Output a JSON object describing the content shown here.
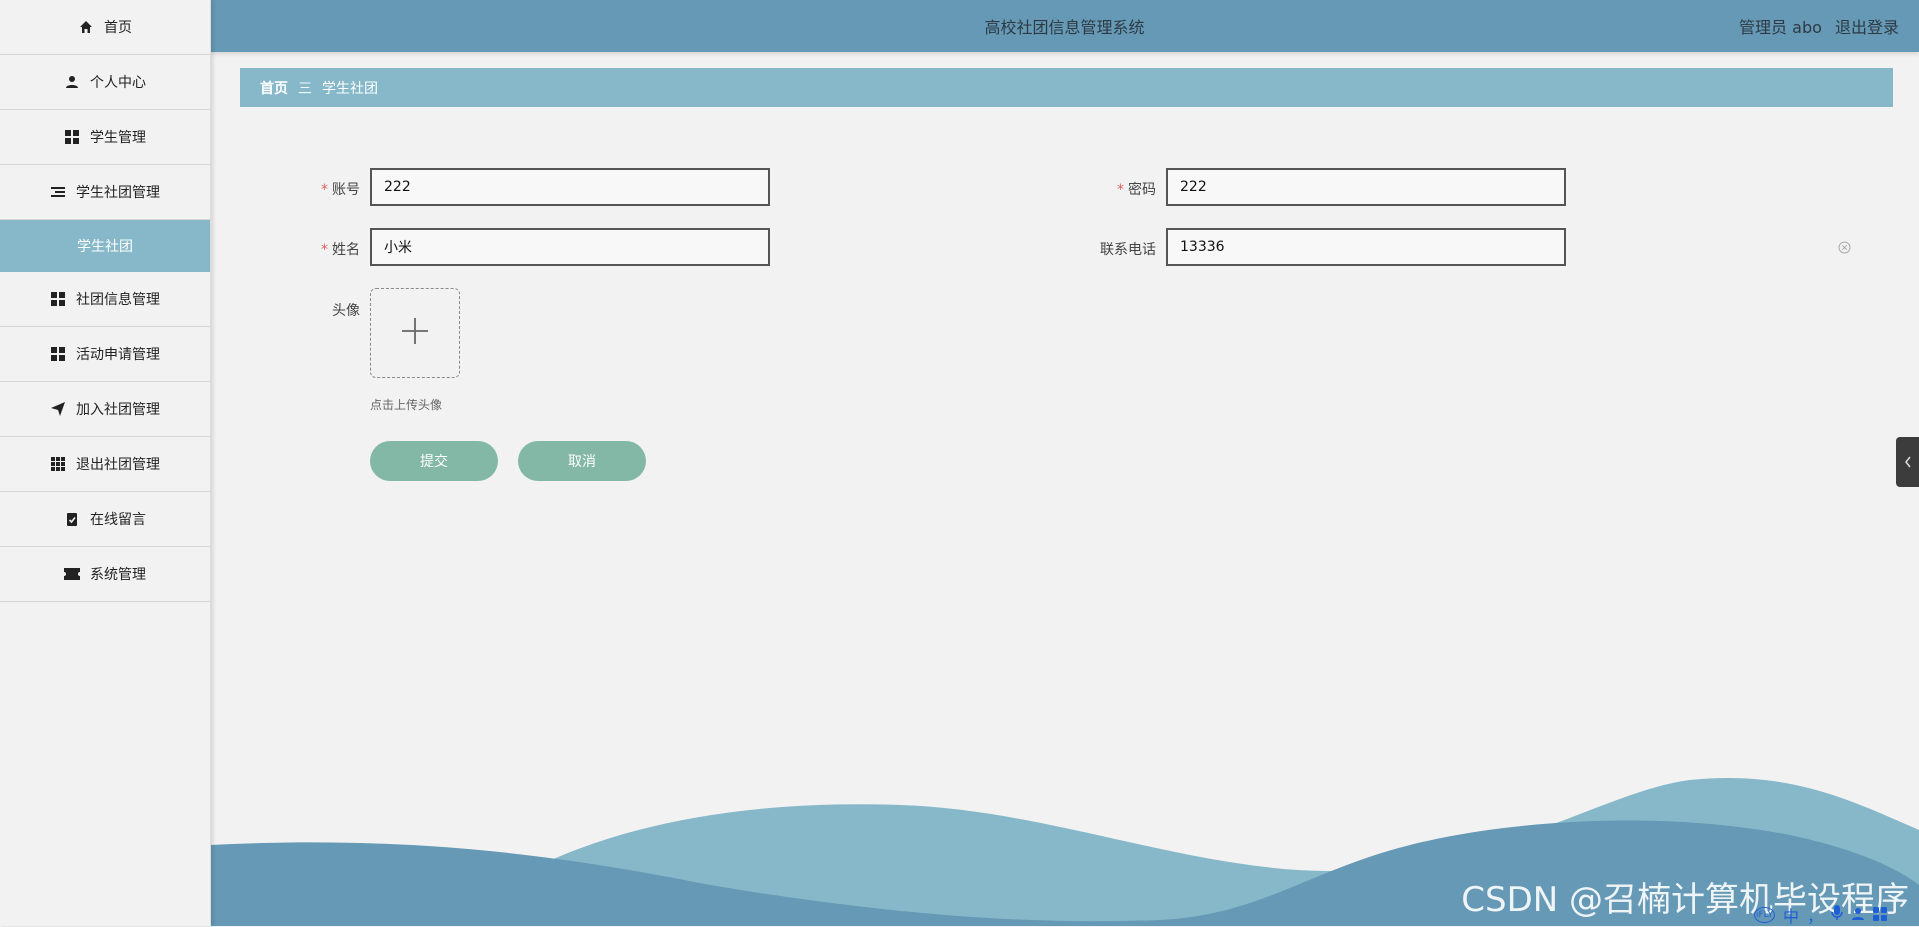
{
  "header": {
    "title": "高校社团信息管理系统",
    "user_label": "管理员 abo",
    "logout_label": "退出登录"
  },
  "sidebar": {
    "items": [
      {
        "label": "首页",
        "icon": "home-icon"
      },
      {
        "label": "个人中心",
        "icon": "user-icon"
      },
      {
        "label": "学生管理",
        "icon": "grid-icon"
      },
      {
        "label": "学生社团管理",
        "icon": "list-icon"
      },
      {
        "label": "学生社团",
        "icon": "",
        "active": true
      },
      {
        "label": "社团信息管理",
        "icon": "grid-icon"
      },
      {
        "label": "活动申请管理",
        "icon": "grid-icon"
      },
      {
        "label": "加入社团管理",
        "icon": "paper-plane-icon"
      },
      {
        "label": "退出社团管理",
        "icon": "apps-icon"
      },
      {
        "label": "在线留言",
        "icon": "clipboard-check-icon"
      },
      {
        "label": "系统管理",
        "icon": "ticket-icon"
      }
    ]
  },
  "breadcrumb": {
    "home": "首页",
    "separator": "三",
    "current": "学生社团"
  },
  "form": {
    "account": {
      "label": "账号",
      "value": "222",
      "required": true
    },
    "password": {
      "label": "密码",
      "value": "222",
      "required": true
    },
    "name": {
      "label": "姓名",
      "value": "小米",
      "required": true
    },
    "phone": {
      "label": "联系电话",
      "value": "13336",
      "required": false
    },
    "avatar": {
      "label": "头像",
      "tip": "点击上传头像"
    },
    "submit_label": "提交",
    "cancel_label": "取消"
  },
  "watermark": "CSDN @召楠计算机毕设程序",
  "ime": {
    "logo": "iFLY",
    "lang": "中",
    "punct": "，"
  },
  "colors": {
    "header": "#6599b5",
    "accent": "#86b8c9",
    "button": "#82b8a5",
    "required": "#e06060"
  }
}
